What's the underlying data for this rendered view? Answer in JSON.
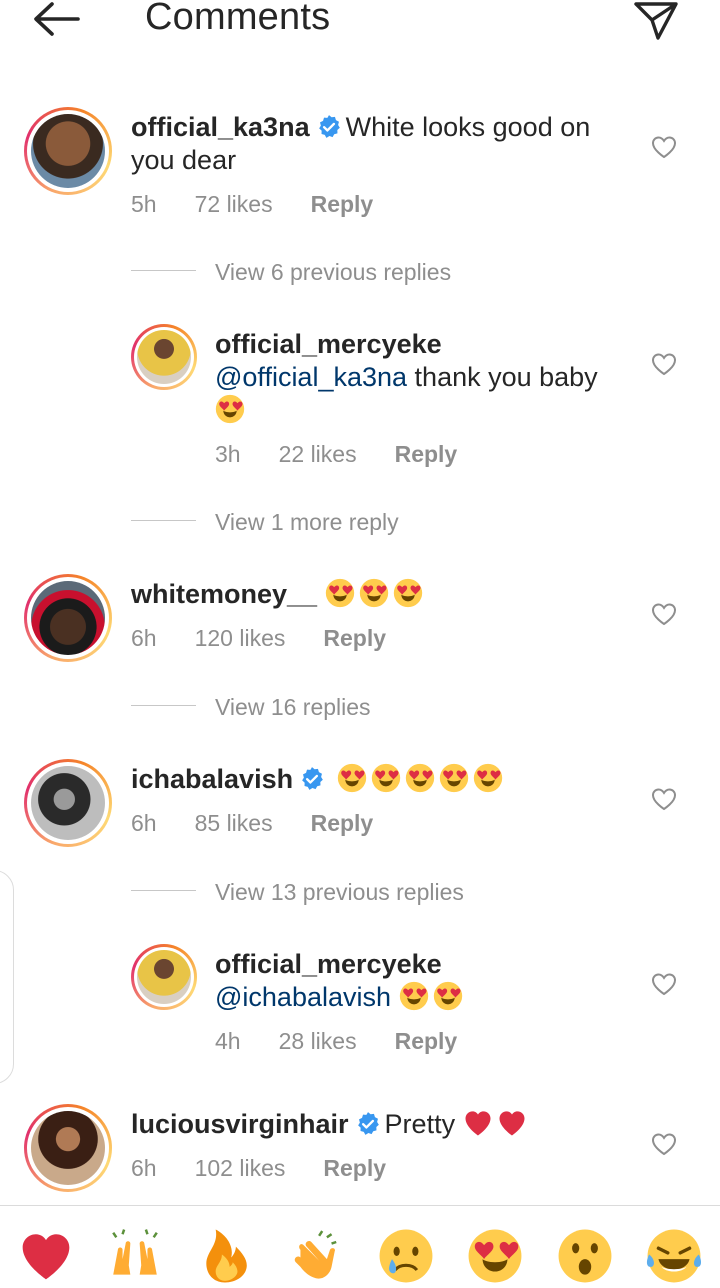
{
  "header": {
    "title": "Comments"
  },
  "comments": [
    {
      "user": "official_ka3na",
      "verified": true,
      "text_line1": "White looks good on",
      "text_line2": "you dear",
      "time": "5h",
      "likes": "72 likes",
      "reply": "Reply",
      "view_replies": "View 6 previous replies"
    },
    {
      "user": "official_mercyeke",
      "mention": "@official_ka3na",
      "text": " thank you baby",
      "emoji_count": 1,
      "time": "3h",
      "likes": "22 likes",
      "reply": "Reply",
      "view_replies": "View 1 more reply"
    },
    {
      "user": "whitemoney__",
      "emoji_count": 3,
      "time": "6h",
      "likes": "120 likes",
      "reply": "Reply",
      "view_replies": "View 16 replies"
    },
    {
      "user": "ichabalavish",
      "verified": true,
      "emoji_count": 5,
      "time": "6h",
      "likes": "85 likes",
      "reply": "Reply",
      "view_replies": "View 13 previous replies"
    },
    {
      "user": "official_mercyeke",
      "mention": "@ichabalavish",
      "emoji_count": 2,
      "time": "4h",
      "likes": "28 likes",
      "reply": "Reply"
    },
    {
      "user": "luciousvirginhair",
      "verified": true,
      "text": "Pretty",
      "time": "6h",
      "likes": "102 likes",
      "reply": "Reply"
    }
  ],
  "reactions": [
    "red-heart",
    "raising-hands",
    "fire",
    "clapping-hands",
    "crying-face",
    "heart-eyes",
    "surprised-face",
    "tears-of-joy"
  ],
  "colors": {
    "mention": "#00376b",
    "verified": "#3897f0",
    "meta": "#8e8e8e",
    "story_ring": "#e1306c"
  }
}
